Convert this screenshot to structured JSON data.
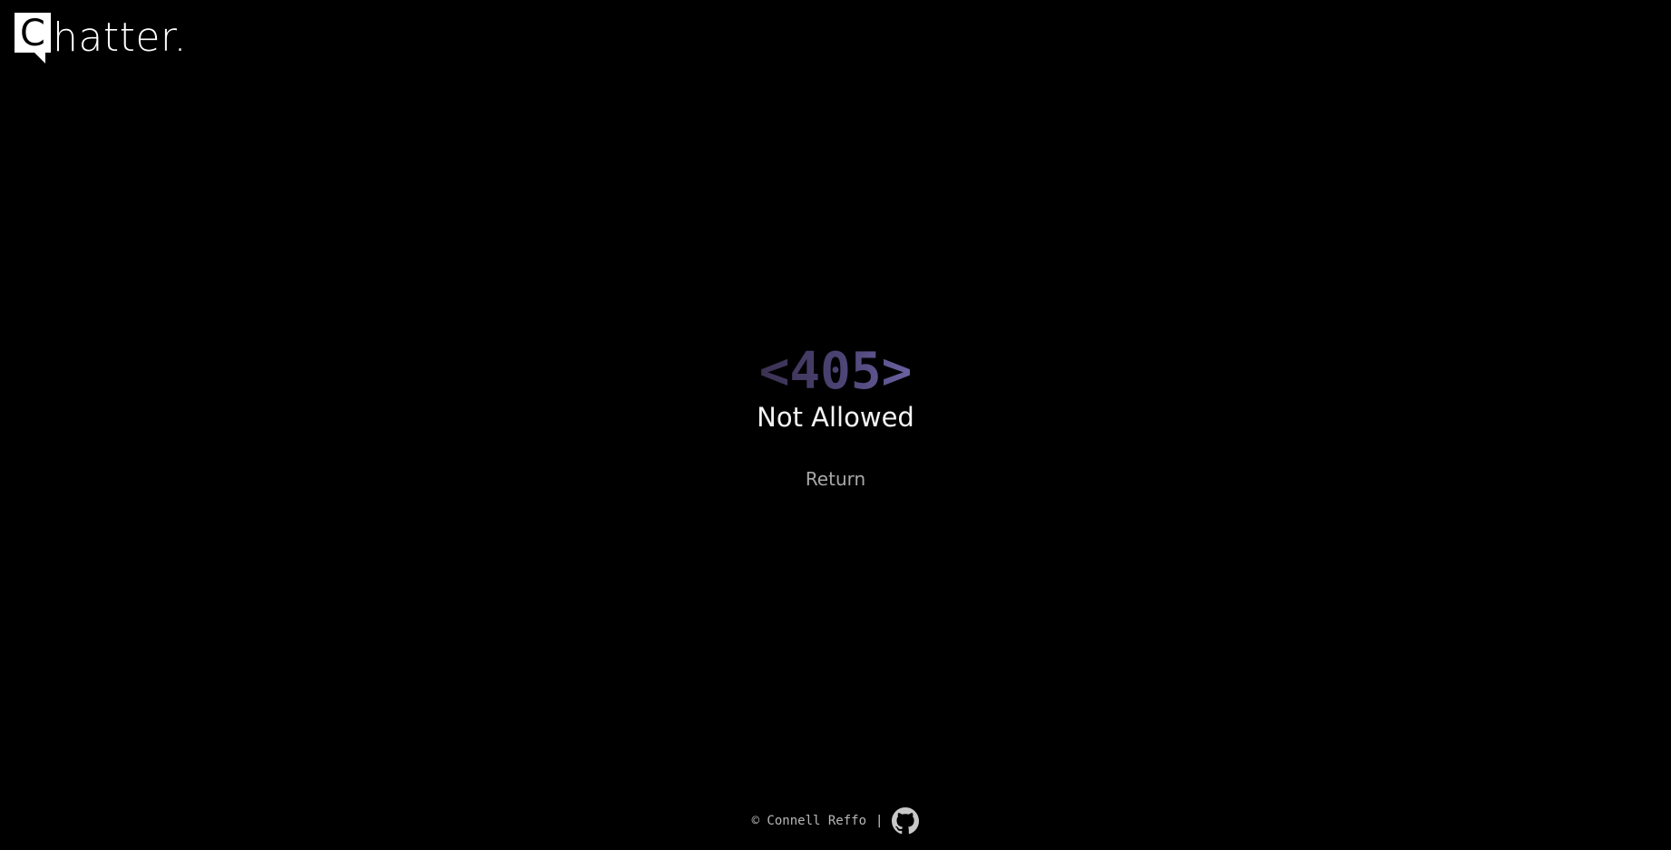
{
  "brand": {
    "logo_letter": "C",
    "name": "hatter."
  },
  "error": {
    "code": "<405>",
    "message": "Not Allowed",
    "return_label": "Return"
  },
  "footer": {
    "copyright": "© Connell Reffo",
    "separator": "|",
    "github_icon": "github-icon"
  },
  "colors": {
    "background": "#000000",
    "code_gradient_start": "#3a3152",
    "code_gradient_end": "#6a62a2",
    "message": "#f4f4f4",
    "return_link": "#a8a8a8",
    "footer_text": "#b8b8b8"
  }
}
